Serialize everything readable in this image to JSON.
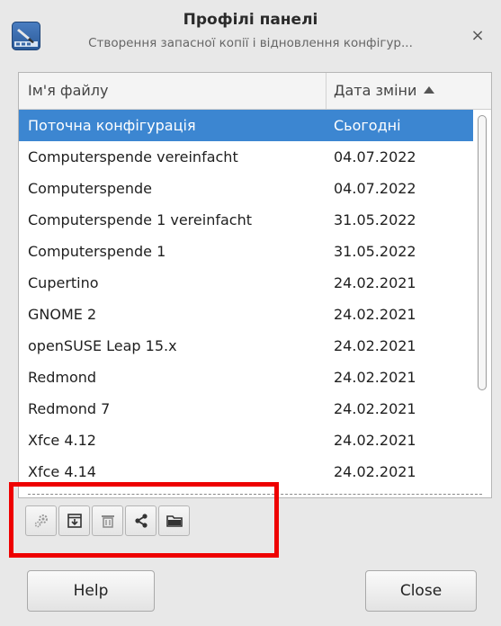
{
  "window": {
    "title": "Профілі панелі",
    "subtitle": "Створення запасної копії і відновлення конфігур...",
    "close_glyph": "×"
  },
  "list": {
    "columns": {
      "name": "Ім'я файлу",
      "date": "Дата зміни"
    },
    "sort_column": "date",
    "rows": [
      {
        "name": "Поточна конфігурація",
        "date": "Сьогодні",
        "selected": true
      },
      {
        "name": "Computerspende vereinfacht",
        "date": "04.07.2022"
      },
      {
        "name": "Computerspende",
        "date": "04.07.2022"
      },
      {
        "name": "Computerspende 1  vereinfacht",
        "date": "31.05.2022"
      },
      {
        "name": "Computerspende 1",
        "date": "31.05.2022"
      },
      {
        "name": "Cupertino",
        "date": "24.02.2021"
      },
      {
        "name": "GNOME 2",
        "date": "24.02.2021"
      },
      {
        "name": "openSUSE Leap 15.x",
        "date": "24.02.2021"
      },
      {
        "name": "Redmond",
        "date": "24.02.2021"
      },
      {
        "name": "Redmond 7",
        "date": "24.02.2021"
      },
      {
        "name": "Xfce 4.12",
        "date": "24.02.2021"
      },
      {
        "name": "Xfce 4.14",
        "date": "24.02.2021"
      }
    ]
  },
  "toolbar": {
    "icons": [
      "gear-icon",
      "import-icon",
      "trash-icon",
      "share-icon",
      "folder-icon"
    ]
  },
  "buttons": {
    "help": "Help",
    "close": "Close"
  },
  "colors": {
    "selection": "#3c86d1",
    "highlight": "#ee0000"
  }
}
